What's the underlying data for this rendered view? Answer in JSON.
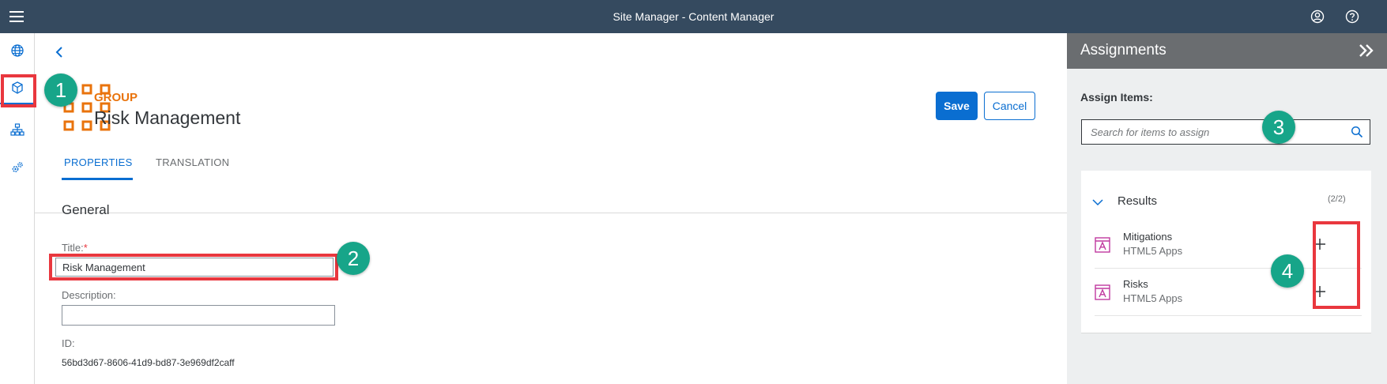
{
  "shell": {
    "title": "Site Manager - Content Manager",
    "menu_icon": "menu-icon",
    "user_icon": "user-icon",
    "help_icon": "help-icon"
  },
  "sidenav": {
    "items": [
      {
        "icon": "globe-icon",
        "active": false
      },
      {
        "icon": "content-cube-icon",
        "active": true
      },
      {
        "icon": "hierarchy-icon",
        "active": false
      },
      {
        "icon": "settings-gears-icon",
        "active": false
      }
    ]
  },
  "header": {
    "type_label": "GROUP",
    "title": "Risk Management",
    "save_label": "Save",
    "cancel_label": "Cancel",
    "group_icon": "group-tiles-icon"
  },
  "tabs": [
    {
      "label": "PROPERTIES",
      "active": true
    },
    {
      "label": "TRANSLATION",
      "active": false
    }
  ],
  "general": {
    "section_title": "General",
    "title_label": "Title:",
    "required_mark": "*",
    "title_value": "Risk Management",
    "description_label": "Description:",
    "description_value": "",
    "id_label": "ID:",
    "id_value": "56bd3d67-8606-41d9-bd87-3e969df2caff"
  },
  "assignments": {
    "title": "Assignments",
    "assign_label": "Assign Items:",
    "search_placeholder": "Search for items to assign",
    "results_title": "Results",
    "results_count": "(2/2)",
    "items": [
      {
        "title": "Mitigations",
        "subtitle": "HTML5 Apps",
        "icon": "html5-app-icon"
      },
      {
        "title": "Risks",
        "subtitle": "HTML5 Apps",
        "icon": "html5-app-icon"
      }
    ]
  },
  "markers": [
    "1",
    "2",
    "3",
    "4"
  ],
  "colors": {
    "shell": "#354a5f",
    "accent": "#0a6ed1",
    "group_orange": "#e9730c",
    "highlight": "#e9373e",
    "marker": "#17a589",
    "app_icon": "#c0399f"
  }
}
